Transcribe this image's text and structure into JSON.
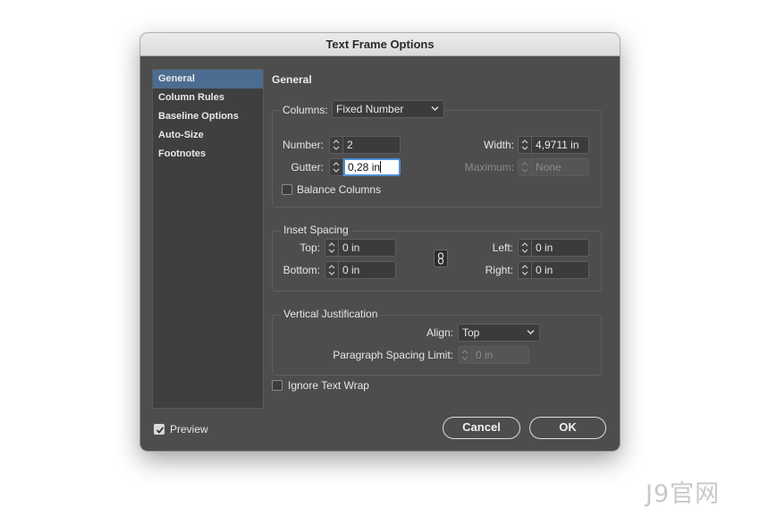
{
  "dialog": {
    "title": "Text Frame Options"
  },
  "sidebar": {
    "items": [
      {
        "label": "General",
        "active": true
      },
      {
        "label": "Column Rules"
      },
      {
        "label": "Baseline Options"
      },
      {
        "label": "Auto-Size"
      },
      {
        "label": "Footnotes"
      }
    ]
  },
  "general": {
    "heading": "General",
    "columns": {
      "label": "Columns:",
      "value": "Fixed Number"
    },
    "number": {
      "label": "Number:",
      "value": "2"
    },
    "gutter": {
      "label": "Gutter:",
      "value": "0,28 in"
    },
    "width": {
      "label": "Width:",
      "value": "4,9711 in"
    },
    "maximum": {
      "label": "Maximum:",
      "value": "None"
    },
    "balance_columns": {
      "label": "Balance Columns",
      "checked": false
    }
  },
  "inset": {
    "legend": "Inset Spacing",
    "top": {
      "label": "Top:",
      "value": "0 in"
    },
    "bottom": {
      "label": "Bottom:",
      "value": "0 in"
    },
    "left": {
      "label": "Left:",
      "value": "0 in"
    },
    "right": {
      "label": "Right:",
      "value": "0 in"
    },
    "link_icon": "chain-link-icon"
  },
  "vertical": {
    "legend": "Vertical Justification",
    "align": {
      "label": "Align:",
      "value": "Top"
    },
    "para_limit": {
      "label": "Paragraph Spacing Limit:",
      "value": "0 in"
    }
  },
  "ignore_wrap": {
    "label": "Ignore Text Wrap",
    "checked": false
  },
  "preview": {
    "label": "Preview",
    "checked": true
  },
  "buttons": {
    "cancel": "Cancel",
    "ok": "OK"
  },
  "watermark": "J9官网",
  "colors": {
    "dialog_bg": "#4d4d4d",
    "sidebar_active": "#4c6c91",
    "focus_ring": "#4f8fd6"
  }
}
